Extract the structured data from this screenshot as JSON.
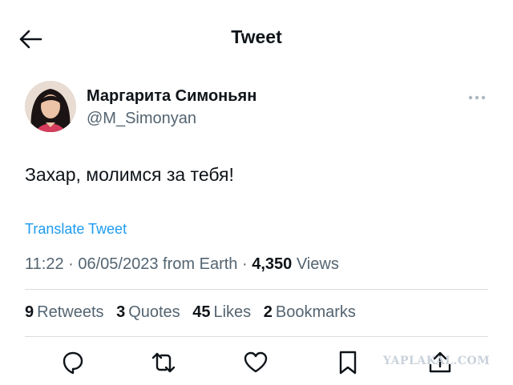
{
  "header": {
    "back_icon": "arrow-left-icon",
    "title": "Tweet"
  },
  "author": {
    "display_name": "Маргарита Симоньян",
    "handle": "@M_Simonyan",
    "more_icon": "more-horizontal-icon"
  },
  "tweet": {
    "text": "Захар, молимся за тебя!",
    "translate_label": "Translate Tweet",
    "time": "11:22",
    "date": "06/05/2023",
    "source": "from Earth",
    "views_count": "4,350",
    "views_label": "Views"
  },
  "stats": {
    "retweets_count": "9",
    "retweets_label": "Retweets",
    "quotes_count": "3",
    "quotes_label": "Quotes",
    "likes_count": "45",
    "likes_label": "Likes",
    "bookmarks_count": "2",
    "bookmarks_label": "Bookmarks"
  },
  "actions": [
    "reply-icon",
    "retweet-icon",
    "like-icon",
    "bookmark-icon",
    "share-icon"
  ],
  "watermark": "YAPLAKAL.COM",
  "colors": {
    "accent": "#1d9bf0",
    "text_primary": "#0f1419",
    "text_secondary": "#536471",
    "divider": "#d9dde1"
  }
}
